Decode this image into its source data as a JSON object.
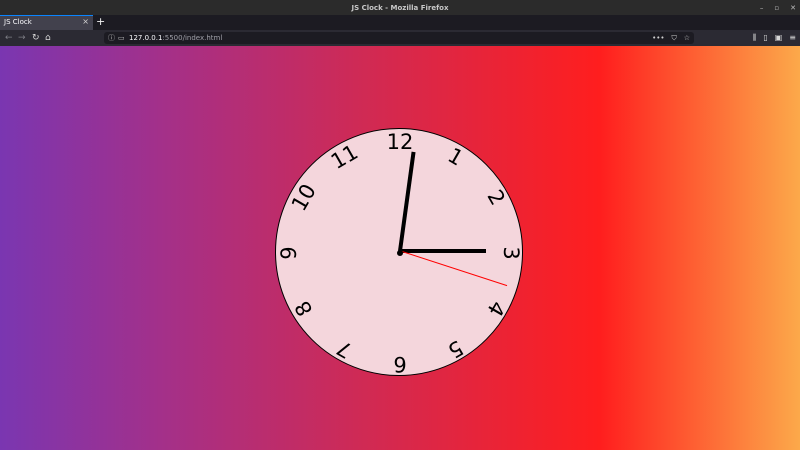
{
  "window": {
    "title": "JS Clock - Mozilla Firefox",
    "controls": [
      "–",
      "▫",
      "✕"
    ]
  },
  "tab": {
    "label": "JS Clock",
    "close": "×",
    "new_tab": "+"
  },
  "nav": {
    "back": "←",
    "forward": "→",
    "reload": "↻",
    "home": "⌂",
    "url_host": "127.0.0.1",
    "url_rest": ":5500/index.html",
    "url_actions": [
      "•••",
      "⛉",
      "☆"
    ],
    "toolbar_icons": [
      "⫼",
      "▯",
      "▣",
      "≡"
    ]
  },
  "clock": {
    "numbers": [
      "12",
      "1",
      "2",
      "3",
      "4",
      "5",
      "6",
      "7",
      "8",
      "9",
      "10",
      "11"
    ],
    "time": {
      "hours": 2,
      "minutes": 1,
      "seconds": 18
    },
    "face_color": "#f4d6dc",
    "second_hand_color": "#ff0000"
  }
}
